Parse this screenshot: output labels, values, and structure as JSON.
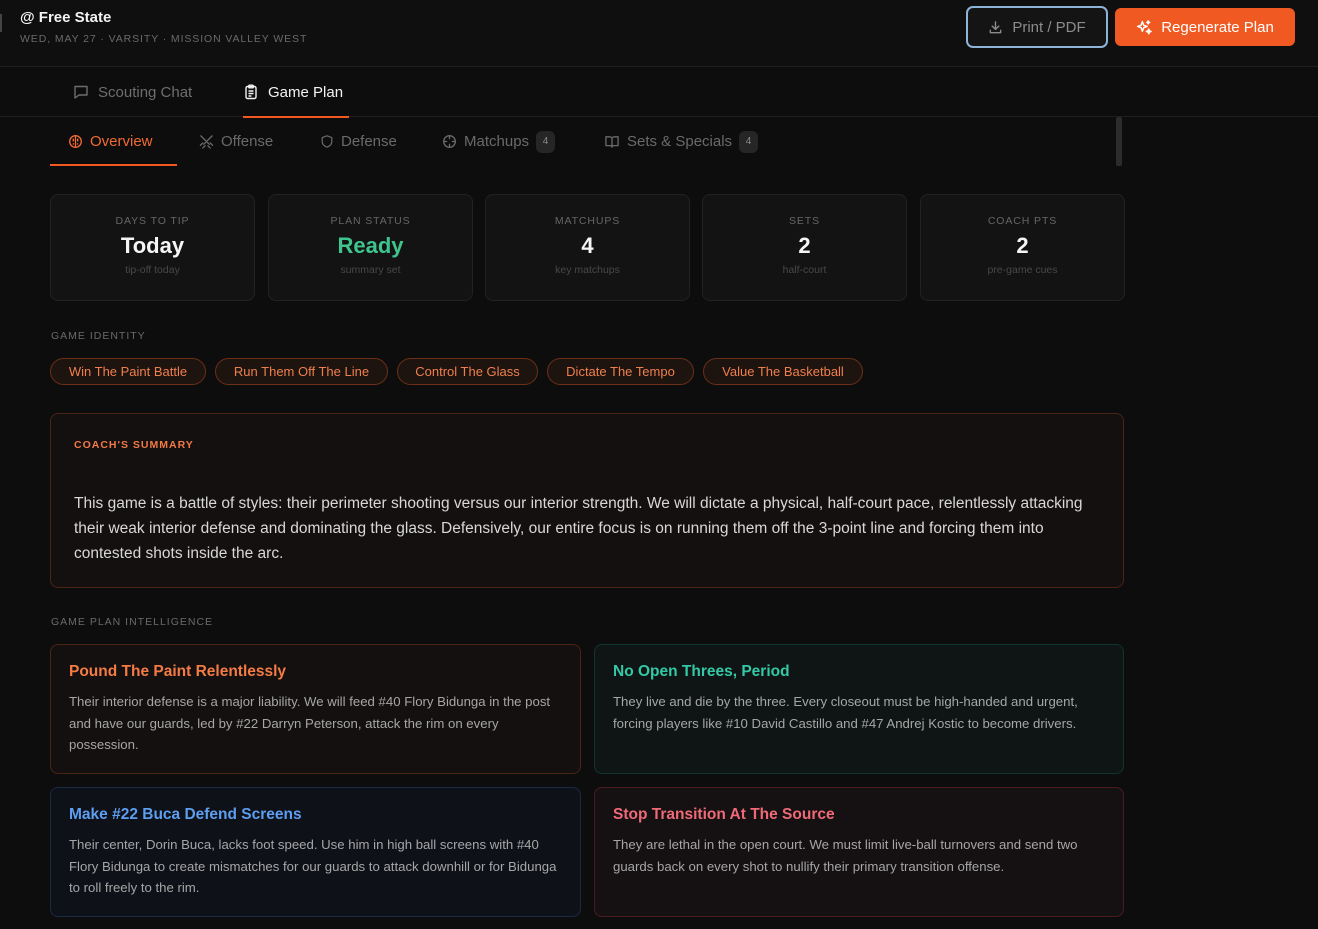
{
  "header": {
    "title": "@ Free State",
    "subtitle": "WED, MAY 27 · VARSITY · MISSION VALLEY WEST",
    "print_label": "Print / PDF",
    "regenerate_label": "Regenerate Plan",
    "accent_color": "#f05a22"
  },
  "tabs": [
    {
      "label": "Scouting Chat",
      "icon": "chat-icon",
      "active": false
    },
    {
      "label": "Game Plan",
      "icon": "clipboard-icon",
      "active": true
    }
  ],
  "subtabs": [
    {
      "label": "Overview",
      "icon": "brain-icon",
      "active": true
    },
    {
      "label": "Offense",
      "icon": "swords-icon",
      "active": false
    },
    {
      "label": "Defense",
      "icon": "shield-icon",
      "active": false
    },
    {
      "label": "Matchups",
      "icon": "crosshair-icon",
      "count": "4",
      "active": false
    },
    {
      "label": "Sets & Specials",
      "icon": "book-icon",
      "count": "4",
      "active": false
    }
  ],
  "stats": [
    {
      "label": "DAYS TO TIP",
      "value": "Today",
      "sub": "tip-off today"
    },
    {
      "label": "PLAN STATUS",
      "value": "Ready",
      "sub": "summary set",
      "color": "#3ec48c"
    },
    {
      "label": "MATCHUPS",
      "value": "4",
      "sub": "key matchups"
    },
    {
      "label": "SETS",
      "value": "2",
      "sub": "half-court"
    },
    {
      "label": "COACH PTS",
      "value": "2",
      "sub": "pre-game cues"
    }
  ],
  "identity": {
    "label": "GAME IDENTITY",
    "chips": [
      "Win The Paint Battle",
      "Run Them Off The Line",
      "Control The Glass",
      "Dictate The Tempo",
      "Value The Basketball"
    ]
  },
  "summary": {
    "label": "COACH'S SUMMARY",
    "text": "This game is a battle of styles: their perimeter shooting versus our interior strength. We will dictate a physical, half-court pace, relentlessly attacking their weak interior defense and dominating the glass. Defensively, our entire focus is on running them off the 3-point line and forcing them into contested shots inside the arc."
  },
  "intelligence": {
    "label": "GAME PLAN INTELLIGENCE",
    "cards": [
      {
        "title": "Pound The Paint Relentlessly",
        "body": "Their interior defense is a major liability. We will feed #40 Flory Bidunga in the post and have our guards, led by #22 Darryn Peterson, attack the rim on every possession.",
        "color": "#f47b44"
      },
      {
        "title": "No Open Threes, Period",
        "body": "They live and die by the three. Every closeout must be high-handed and urgent, forcing players like #10 David Castillo and #47 Andrej Kostic to become drivers.",
        "color": "#34c9a6"
      },
      {
        "title": "Make #22 Buca Defend Screens",
        "body": "Their center, Dorin Buca, lacks foot speed. Use him in high ball screens with #40 Flory Bidunga to create mismatches for our guards to attack downhill or for Bidunga to roll freely to the rim.",
        "color": "#5d9ef0"
      },
      {
        "title": "Stop Transition At The Source",
        "body": "They are lethal in the open court. We must limit live-ball turnovers and send two guards back on every shot to nullify their primary transition offense.",
        "color": "#ef6a77"
      }
    ]
  }
}
